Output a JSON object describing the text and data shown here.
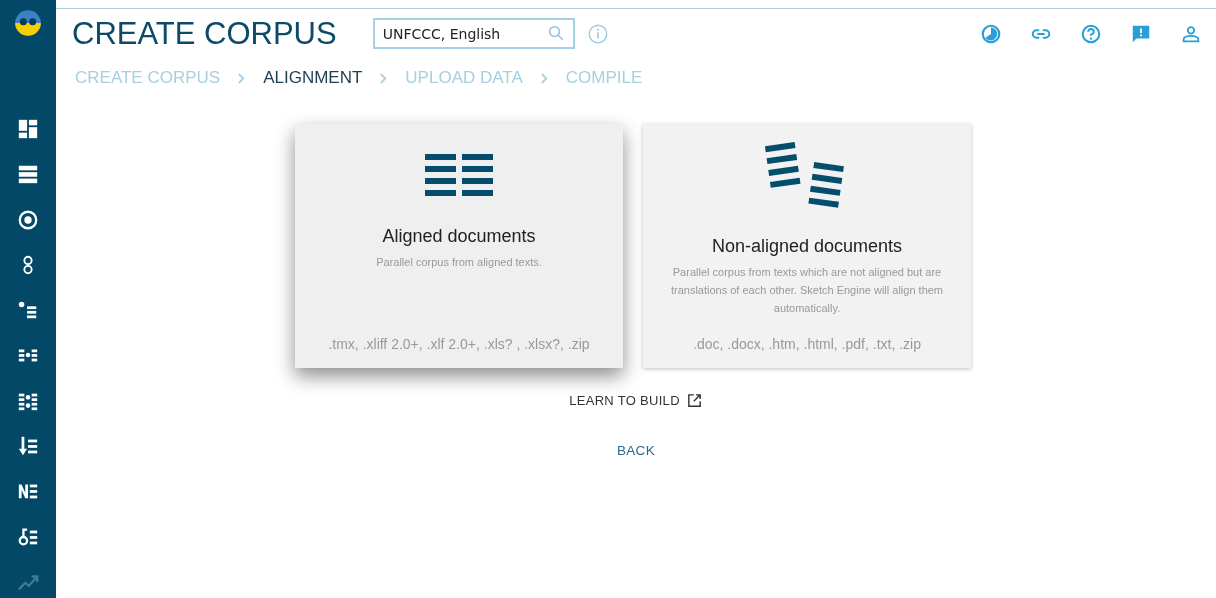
{
  "sidebar": {
    "items": [
      {
        "kind": "dashboard",
        "disabled": false
      },
      {
        "kind": "list",
        "disabled": false
      },
      {
        "kind": "target",
        "disabled": false
      },
      {
        "kind": "rings",
        "disabled": false
      },
      {
        "kind": "dot-list",
        "disabled": false
      },
      {
        "kind": "mid-dot",
        "disabled": false
      },
      {
        "kind": "two-dots",
        "disabled": false
      },
      {
        "kind": "down-list",
        "disabled": false
      },
      {
        "kind": "n-list",
        "disabled": false
      },
      {
        "kind": "key-list",
        "disabled": false
      },
      {
        "kind": "trend",
        "disabled": true
      }
    ]
  },
  "header": {
    "title": "CREATE CORPUS",
    "search": {
      "value": "UNFCCC, English"
    },
    "toolbar": [
      {
        "kind": "theme"
      },
      {
        "kind": "link"
      },
      {
        "kind": "help"
      },
      {
        "kind": "feedback"
      },
      {
        "kind": "user"
      }
    ]
  },
  "breadcrumb": [
    {
      "label": "CREATE CORPUS",
      "selected": false
    },
    {
      "label": "ALIGNMENT",
      "selected": true
    },
    {
      "label": "UPLOAD DATA",
      "selected": false
    },
    {
      "label": "COMPILE",
      "selected": false
    }
  ],
  "cards": [
    {
      "kind": "aligned",
      "title": "Aligned documents",
      "description": "Parallel corpus from aligned texts.",
      "formats": ".tmx, .xliff 2.0+, .xlf 2.0+, .xls? , .xlsx?, .zip",
      "highlighted": true
    },
    {
      "kind": "non-aligned",
      "title": "Non-aligned documents",
      "description": "Parallel corpus from texts which are not aligned but are translations of each other. Sketch Engine will align them automatically.",
      "formats": ".doc, .docx, .htm, .html, .pdf, .txt, .zip",
      "highlighted": false
    }
  ],
  "learn_link": "LEARN TO BUILD",
  "back_button": "BACK"
}
